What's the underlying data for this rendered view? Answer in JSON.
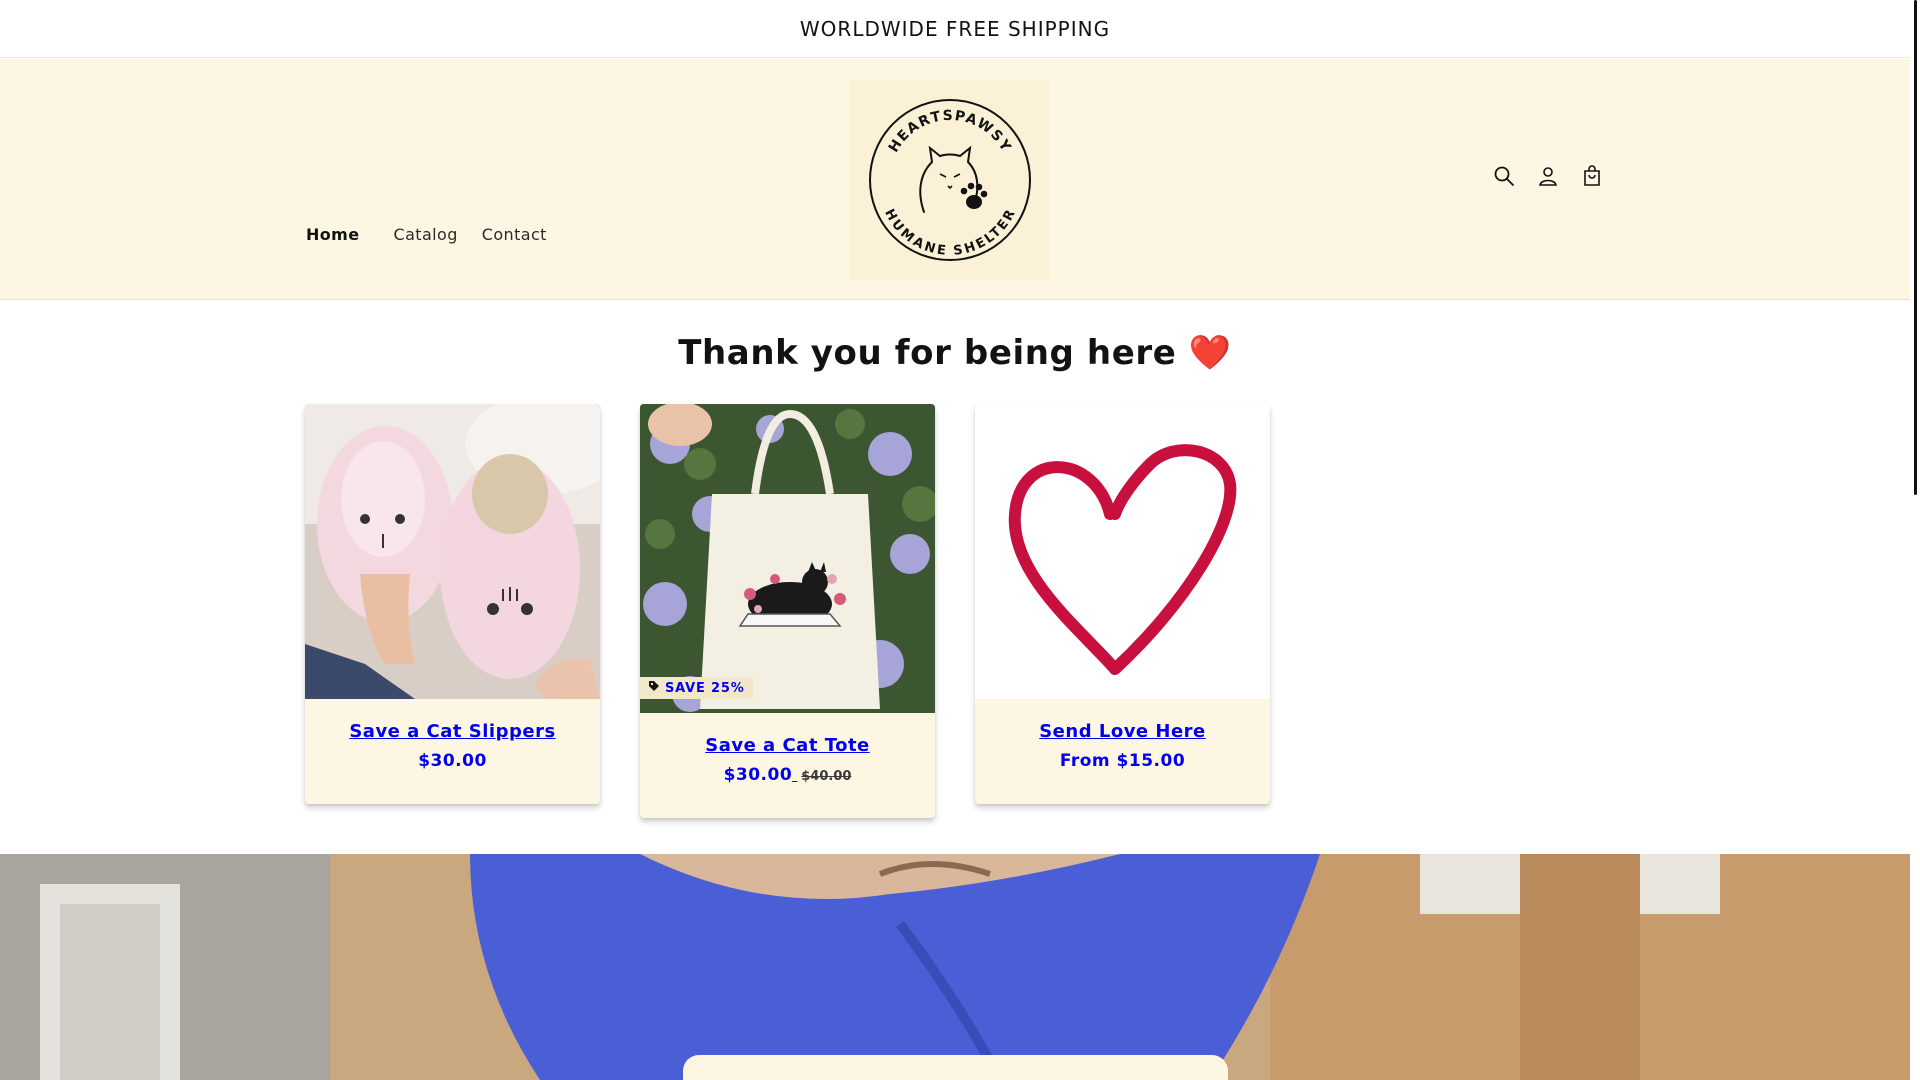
{
  "announcement": {
    "text": "WORLDWIDE FREE SHIPPING"
  },
  "header": {
    "nav": [
      {
        "label": "Home"
      },
      {
        "label": "Catalog"
      },
      {
        "label": "Contact"
      }
    ],
    "logo": {
      "top_text": "HEARTSPAWSY",
      "bottom_text": "HUMANE SHELTER"
    },
    "icons": [
      "search-icon",
      "account-icon",
      "cart-icon"
    ]
  },
  "main": {
    "heading": "Thank you for being here ❤️",
    "products": [
      {
        "title": "Save a Cat Slippers",
        "price": "$30.00"
      },
      {
        "title": "Save a Cat Tote",
        "price": "$30.00",
        "compare_price": "$40.00",
        "badge": "SAVE 25%"
      },
      {
        "title": "Send Love Here",
        "price": "From $15.00"
      }
    ]
  },
  "colors": {
    "header_bg": "#fdf6e3",
    "card_bg": "#fdf6e3",
    "heart": "#c8103e",
    "banner_shirt": "#4a5fd6"
  }
}
